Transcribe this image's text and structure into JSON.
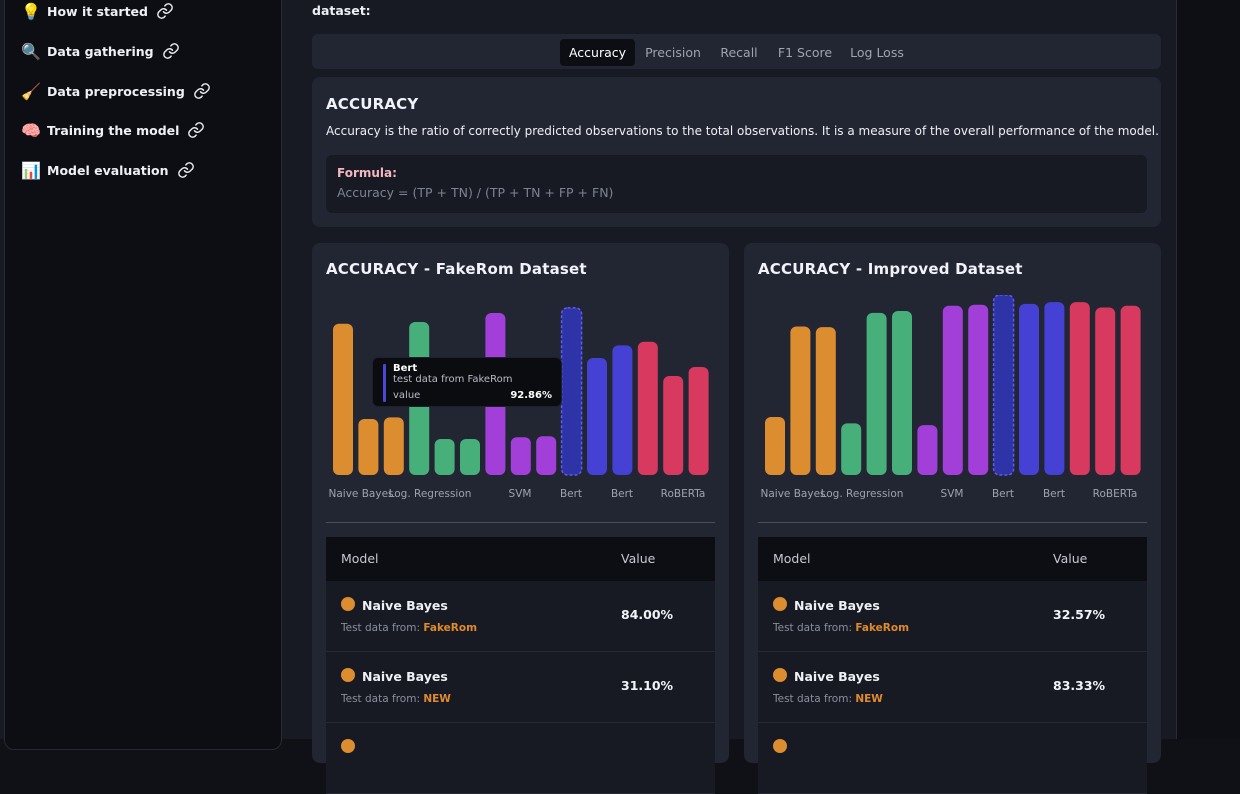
{
  "sidebar": {
    "items": [
      {
        "emoji": "💡",
        "label": "How it started"
      },
      {
        "emoji": "🔍",
        "label": "Data gathering"
      },
      {
        "emoji": "🧹",
        "label": "Data preprocessing"
      },
      {
        "emoji": "🧠",
        "label": "Training the model"
      },
      {
        "emoji": "📊",
        "label": "Model evaluation"
      }
    ],
    "link_icon": "link-icon"
  },
  "main": {
    "intro_text": "dataset:",
    "tabs": [
      {
        "label": "Accuracy",
        "active": true
      },
      {
        "label": "Precision",
        "active": false
      },
      {
        "label": "Recall",
        "active": false
      },
      {
        "label": "F1 Score",
        "active": false
      },
      {
        "label": "Log Loss",
        "active": false
      }
    ],
    "metric": {
      "title": "ACCURACY",
      "description": "Accuracy is the ratio of correctly predicted observations to the total observations. It is a measure of the overall performance of the model.",
      "formula_label": "Formula:",
      "formula": "Accuracy = (TP + TN) / (TP + TN + FP + FN)"
    }
  },
  "colors": {
    "naive_bayes": "#dc8d2f",
    "log_regression": "#47b07a",
    "svm": "#a23fd8",
    "bert": "#4441d4",
    "roberta": "#d8395f",
    "bert_highlight": "#2f33a8"
  },
  "chart_data": [
    {
      "type": "bar",
      "title": "ACCURACY - FakeRom Dataset",
      "tick_labels": [
        "Naive Bayes",
        "Log. Regression",
        "SVM",
        "Bert",
        "Bert",
        "RoBERTa"
      ],
      "groups": [
        "Naive Bayes",
        "Naive Bayes",
        "Naive Bayes",
        "Log. Regression",
        "Log. Regression",
        "Log. Regression",
        "SVM",
        "SVM",
        "SVM",
        "Bert",
        "Bert",
        "Bert",
        "RoBERTa",
        "RoBERTa",
        "RoBERTa"
      ],
      "values": [
        84.0,
        31.1,
        32.0,
        85.0,
        20.0,
        20.0,
        90.0,
        21.0,
        21.5,
        92.86,
        65.0,
        72.0,
        74.0,
        55.0,
        60.0
      ],
      "highlighted_index": 9,
      "ylim": [
        0,
        100
      ],
      "tooltip": {
        "name": "Bert",
        "detail": "test data from FakeRom",
        "value_label": "value",
        "value": "92.86%"
      },
      "table": {
        "headers": [
          "Model",
          "Value"
        ],
        "rows": [
          {
            "name": "Naive Bayes",
            "source_label": "Test data from:",
            "source": "FakeRom",
            "value": "84.00%"
          },
          {
            "name": "Naive Bayes",
            "source_label": "Test data from:",
            "source": "NEW",
            "value": "31.10%"
          }
        ]
      }
    },
    {
      "type": "bar",
      "title": "ACCURACY - Improved Dataset",
      "tick_labels": [
        "Naive Bayes",
        "Log. Regression",
        "SVM",
        "Bert",
        "Bert",
        "RoBERTa"
      ],
      "groups": [
        "Naive Bayes",
        "Naive Bayes",
        "Naive Bayes",
        "Log. Regression",
        "Log. Regression",
        "Log. Regression",
        "SVM",
        "SVM",
        "SVM",
        "Bert",
        "Bert",
        "Bert",
        "RoBERTa",
        "RoBERTa",
        "RoBERTa"
      ],
      "values": [
        32.57,
        83.33,
        83.0,
        29.0,
        91.0,
        92.0,
        28.0,
        95.0,
        95.5,
        101.0,
        96.0,
        97.0,
        97.0,
        94.0,
        95.0
      ],
      "highlighted_index": 9,
      "ylim": [
        0,
        101
      ],
      "table": {
        "headers": [
          "Model",
          "Value"
        ],
        "rows": [
          {
            "name": "Naive Bayes",
            "source_label": "Test data from:",
            "source": "FakeRom",
            "value": "32.57%"
          },
          {
            "name": "Naive Bayes",
            "source_label": "Test data from:",
            "source": "NEW",
            "value": "83.33%"
          }
        ]
      }
    }
  ]
}
